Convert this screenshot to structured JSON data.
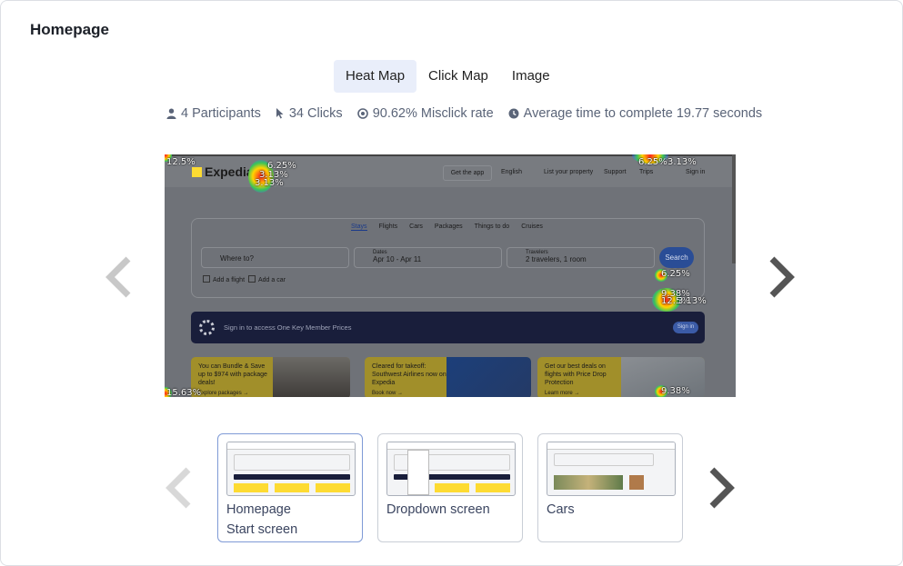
{
  "page": {
    "title": "Homepage"
  },
  "tabs": [
    {
      "label": "Heat Map",
      "active": true
    },
    {
      "label": "Click Map",
      "active": false
    },
    {
      "label": "Image",
      "active": false
    }
  ],
  "stats": {
    "participants": "4 Participants",
    "clicks": "34 Clicks",
    "misclick": "90.62% Misclick rate",
    "avg_time": "Average time to complete 19.77 seconds"
  },
  "screenshot": {
    "brand": "Expedia",
    "nav": [
      "Get the app",
      "English",
      "List your property",
      "Support",
      "Trips",
      "Sign in"
    ],
    "search_tabs": [
      "Stays",
      "Flights",
      "Cars",
      "Packages",
      "Things to do",
      "Cruises"
    ],
    "where_placeholder": "Where to?",
    "dates_label": "Dates",
    "dates_value": "Apr 10 - Apr 11",
    "travelers_label": "Travelers",
    "travelers_value": "2 travelers, 1 room",
    "search_button": "Search",
    "add_flight": "Add a flight",
    "add_car": "Add a car",
    "member_banner": "Sign in to access One Key Member Prices",
    "member_button": "Sign in",
    "promos": [
      {
        "text": "You can Bundle & Save up to $974 with package deals!",
        "link": "Explore packages →"
      },
      {
        "text": "Cleared for takeoff: Southwest Airlines now on Expedia",
        "link": "Book now →"
      },
      {
        "text": "Get our best deals on flights with Price Drop Protection",
        "link": "Learn more →"
      }
    ],
    "heat_labels": [
      "12.5%",
      "6.25%",
      "3.13%",
      "3.13%",
      "6.25%",
      "3.13%",
      "6.25%",
      "9.38%",
      "12.5%",
      "3.13%",
      "15.63%",
      "9.38%"
    ]
  },
  "thumbnails": [
    {
      "name": "Homepage",
      "sub": "Start screen",
      "active": true
    },
    {
      "name": "Dropdown screen",
      "sub": "",
      "active": false
    },
    {
      "name": "Cars",
      "sub": "",
      "active": false
    }
  ],
  "colors": {
    "accent": "#1668e3",
    "brand_yellow": "#fddb32",
    "nav_dark": "#191e3b",
    "tab_active_bg": "#e9eefa"
  }
}
